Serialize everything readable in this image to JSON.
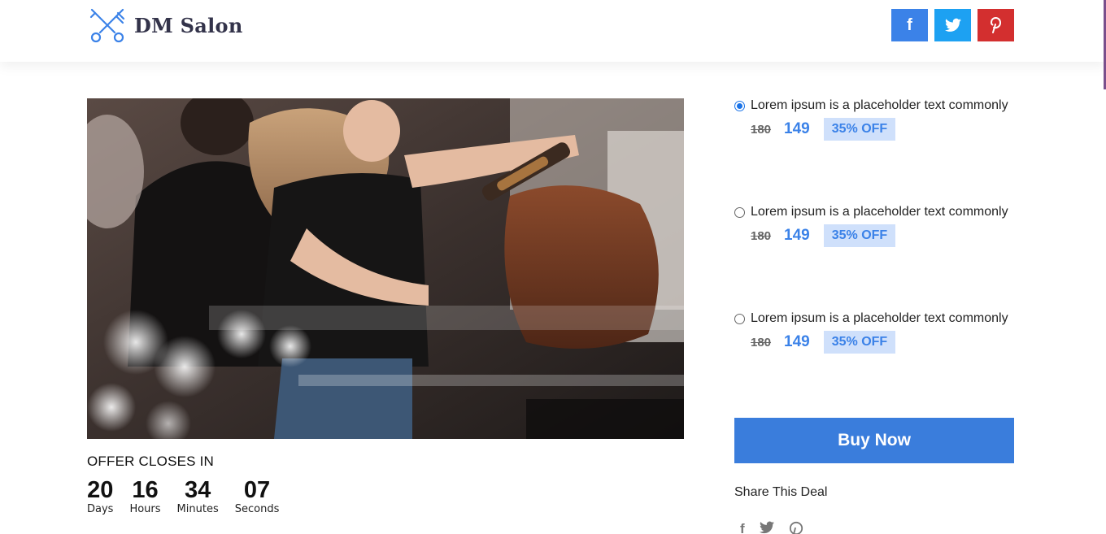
{
  "brand": {
    "name": "DM Salon",
    "logo_icon": "scissors-comb-icon",
    "color": "#3b82e8"
  },
  "header_social": [
    {
      "name": "facebook",
      "glyph": "f",
      "color": "#3b82e8"
    },
    {
      "name": "twitter",
      "glyph": "t",
      "color": "#1da1f2"
    },
    {
      "name": "pinterest",
      "glyph": "p",
      "color": "#d32f2f"
    }
  ],
  "hero_image": {
    "description": "hairstylist-curling-hair"
  },
  "offer": {
    "title": "OFFER CLOSES IN",
    "countdown": [
      {
        "value": "20",
        "label": "Days"
      },
      {
        "value": "16",
        "label": "Hours"
      },
      {
        "value": "34",
        "label": "Minutes"
      },
      {
        "value": "07",
        "label": "Seconds"
      }
    ]
  },
  "options": [
    {
      "text": "Lorem ipsum is a placeholder text commonly",
      "old_price": "180",
      "new_price": "149",
      "discount": "35% OFF",
      "selected": true
    },
    {
      "text": "Lorem ipsum is a placeholder text commonly",
      "old_price": "180",
      "new_price": "149",
      "discount": "35% OFF",
      "selected": false
    },
    {
      "text": "Lorem ipsum is a placeholder text commonly",
      "old_price": "180",
      "new_price": "149",
      "discount": "35% OFF",
      "selected": false
    }
  ],
  "buy_button": {
    "label": "Buy Now",
    "color": "#3a7ddc"
  },
  "share": {
    "title": "Share This Deal",
    "icons": [
      "facebook-icon",
      "twitter-icon",
      "pinterest-icon"
    ]
  }
}
